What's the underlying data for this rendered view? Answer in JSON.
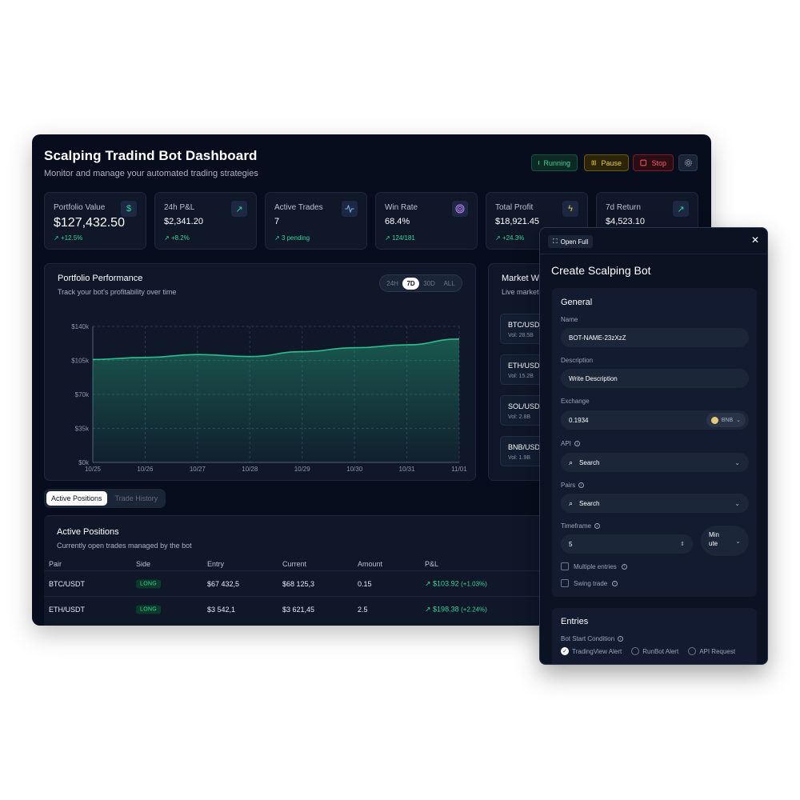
{
  "dashboard": {
    "title": "Scalping Tradind Bot Dashboard",
    "subtitle": "Monitor and manage your automated trading strategies",
    "buttons": {
      "running": "Running",
      "pause": "Pause",
      "stop": "Stop"
    }
  },
  "stats": [
    {
      "label": "Portfolio Value",
      "value": "$127,432.50",
      "change": "+12.5%",
      "icon": "dollar-icon"
    },
    {
      "label": "24h P&L",
      "value": "$2,341.20",
      "change": "+8.2%",
      "icon": "trend-up-icon"
    },
    {
      "label": "Active Trades",
      "value": "7",
      "change": "3 pending",
      "icon": "activity-icon"
    },
    {
      "label": "Win Rate",
      "value": "68.4%",
      "change": "124/181",
      "icon": "target-icon"
    },
    {
      "label": "Total Profit",
      "value": "$18,921.45",
      "change": "+24.3%",
      "icon": "zap-icon"
    },
    {
      "label": "7d Return",
      "value": "$4,523.10",
      "change": "",
      "icon": "trend-up-icon"
    }
  ],
  "performance": {
    "title": "Portfolio Performance",
    "subtitle": "Track your bot's profitability over time",
    "ranges": [
      "24H",
      "7D",
      "30D",
      "ALL"
    ],
    "active_range": "7D"
  },
  "chart_data": {
    "type": "area",
    "x": [
      "10/25",
      "10/26",
      "10/27",
      "10/28",
      "10/29",
      "10/30",
      "10/31",
      "11/01"
    ],
    "values": [
      106000,
      108000,
      111000,
      109000,
      114000,
      118000,
      121000,
      127000
    ],
    "y_ticks": [
      "$0k",
      "$35k",
      "$70k",
      "$105k",
      "$140k"
    ],
    "ylim": [
      0,
      140000
    ],
    "grid": true,
    "color": "#2bbf8a"
  },
  "market": {
    "title": "Market Wa",
    "subtitle": "Live market",
    "items": [
      {
        "pair": "BTC/USD",
        "vol": "Vol: 28.5B"
      },
      {
        "pair": "ETH/USD",
        "vol": "Vol: 15.2B"
      },
      {
        "pair": "SOL/USD",
        "vol": "Vol: 2.8B"
      },
      {
        "pair": "BNB/USD",
        "vol": "Vol: 1.9B"
      }
    ]
  },
  "tabs": [
    "Active Positions",
    "Trade History"
  ],
  "positions": {
    "title": "Active Positions",
    "subtitle": "Currently open trades managed by the bot",
    "columns": [
      "Pair",
      "Side",
      "Entry",
      "Current",
      "Amount",
      "P&L"
    ],
    "rows": [
      {
        "pair": "BTC/USDT",
        "side": "LONG",
        "entry": "$67 432,5",
        "current": "$68 125,3",
        "amount": "0.15",
        "pnl": "$103.92",
        "pct": "(+1.03%)"
      },
      {
        "pair": "ETH/USDT",
        "side": "LONG",
        "entry": "$3 542,1",
        "current": "$3 621,45",
        "amount": "2.5",
        "pnl": "$198.38",
        "pct": "(+2.24%)"
      }
    ]
  },
  "panel": {
    "open_full": "Open Full",
    "title": "Create Scalping Bot",
    "general": {
      "heading": "General",
      "name_label": "Name",
      "name_value": "BOT-NAME-23zXzZ",
      "desc_label": "Description",
      "desc_value": "Write Description",
      "exchange_label": "Exchange",
      "exchange_value": "0.1934",
      "exchange_coin": "BNB",
      "api_label": "API",
      "api_value": "Search",
      "pairs_label": "Pairs",
      "pairs_value": "Search",
      "timeframe_label": "Timeframe",
      "timeframe_value": "5",
      "timeframe_unit_1": "Min",
      "timeframe_unit_2": "ute",
      "multiple_entries": "Multiple entries",
      "swing_trade": "Swing trade"
    },
    "entries": {
      "heading": "Entries",
      "start_label": "Bot Start Condition",
      "options": [
        "TradingView Alert",
        "RunBot Alert",
        "API Request"
      ],
      "selected": "TradingView Alert"
    }
  }
}
